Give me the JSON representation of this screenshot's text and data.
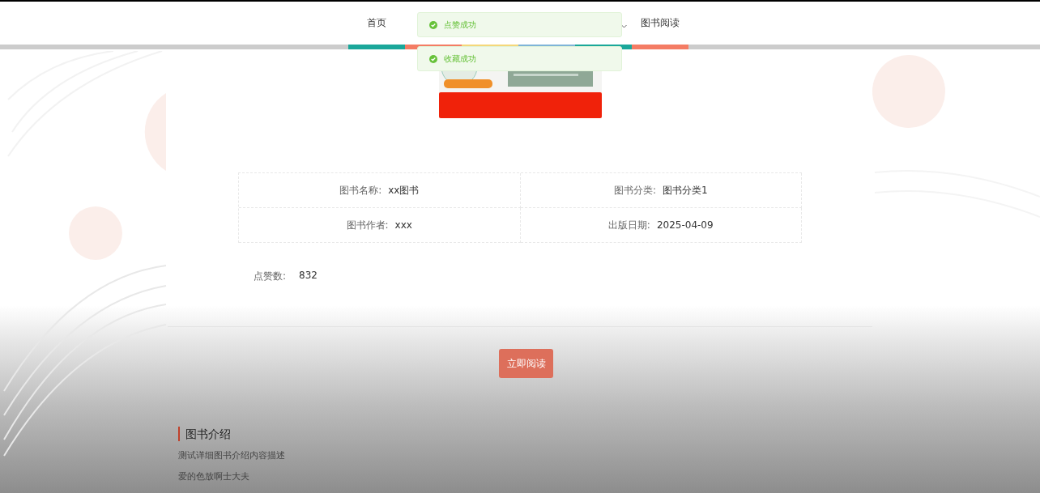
{
  "nav": {
    "items": [
      {
        "label": "首页"
      },
      {
        "label": "图书阅读"
      }
    ]
  },
  "toasts": [
    {
      "text": "点赞成功"
    },
    {
      "text": "收藏成功"
    }
  ],
  "details": [
    [
      {
        "label": "图书名称:",
        "value": "xx图书"
      },
      {
        "label": "图书分类:",
        "value": "图书分类1"
      }
    ],
    [
      {
        "label": "图书作者:",
        "value": "xxx"
      },
      {
        "label": "出版日期:",
        "value": "2025-04-09"
      }
    ]
  ],
  "likes": {
    "label": "点赞数:",
    "value": "832"
  },
  "read_button": "立即阅读",
  "intro": {
    "title": "图书介绍",
    "lines": [
      "测试详细图书介绍内容描述",
      "爱的色放啊士大夫"
    ]
  }
}
